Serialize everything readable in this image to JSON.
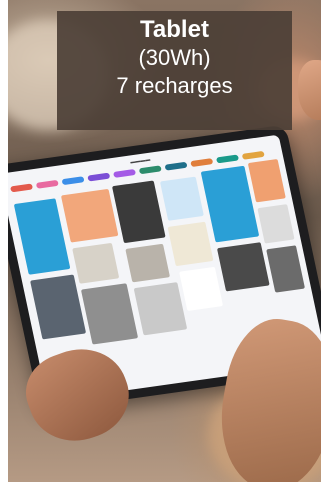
{
  "caption": {
    "title": "Tablet",
    "capacity": "(30Wh)",
    "recharges": "7 recharges"
  },
  "colors": {
    "caption_bg": "#4c3f36",
    "caption_text": "#ffffff"
  }
}
